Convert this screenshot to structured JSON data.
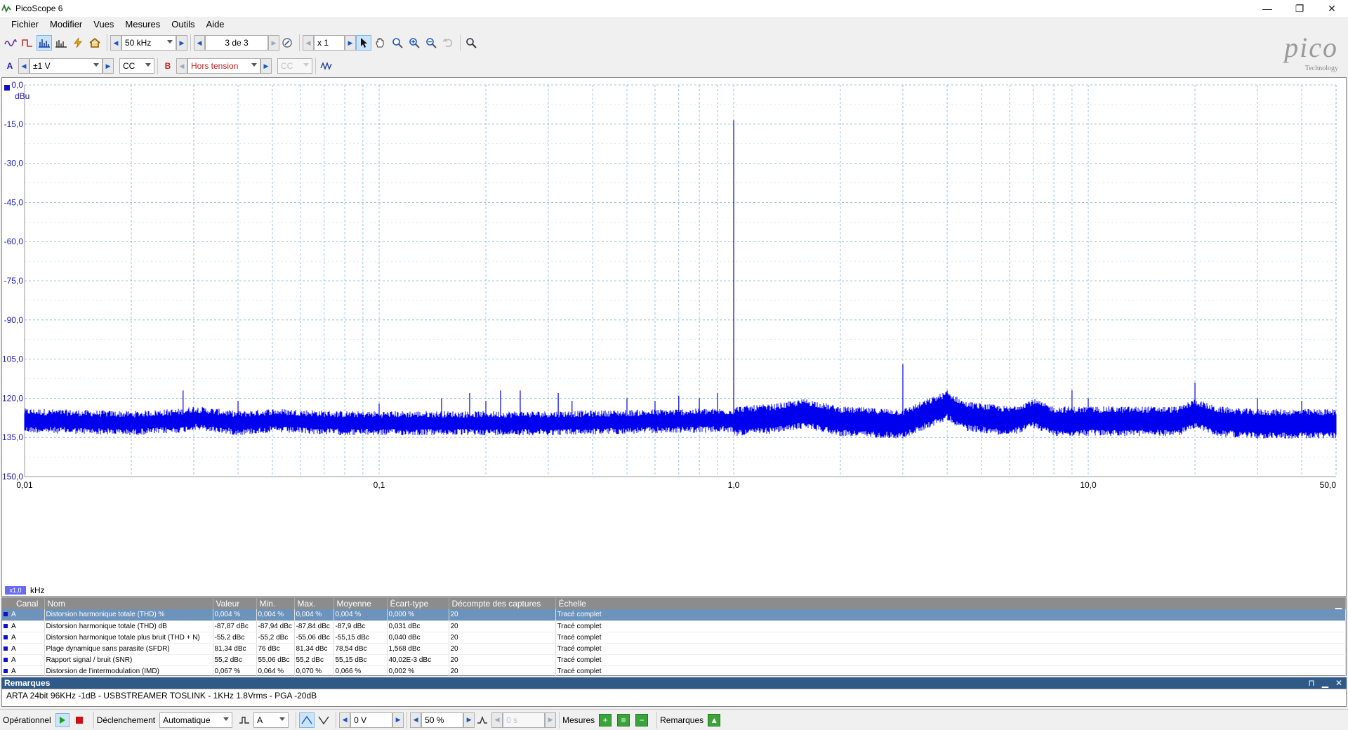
{
  "window": {
    "title": "PicoScope 6",
    "minimize": "—",
    "restore": "❐",
    "close": "✕"
  },
  "menu": [
    "Fichier",
    "Modifier",
    "Vues",
    "Mesures",
    "Outils",
    "Aide"
  ],
  "toolbar": {
    "timebase": "50 kHz",
    "capture": "3 de 3",
    "zoom": "x 1"
  },
  "channels": {
    "a_label": "A",
    "a_range": "±1 V",
    "a_coupling": "CC",
    "b_label": "B",
    "b_range": "Hors tension",
    "b_coupling": "CC"
  },
  "logo": {
    "name": "pico",
    "sub": "Technology"
  },
  "plot": {
    "y_unit": "dBu",
    "x_unit": "kHz",
    "x_scale_badge": "x1,0",
    "colors": {
      "trace": "#0000ee",
      "grid": "#7fb3d5"
    }
  },
  "chart_data": {
    "type": "line",
    "title": "",
    "xlabel": "kHz",
    "ylabel": "dBu",
    "x_scale": "log",
    "xlim": [
      0.01,
      50
    ],
    "ylim": [
      -150,
      0
    ],
    "y_ticks": [
      "0,0",
      "-15,0",
      "-30,0",
      "-45,0",
      "-60,0",
      "-75,0",
      "-90,0",
      "-105,0",
      "-120,0",
      "-135,0",
      "-150,0"
    ],
    "x_ticks": [
      {
        "value": 0.01,
        "label": "0,01"
      },
      {
        "value": 0.1,
        "label": "0,1"
      },
      {
        "value": 1.0,
        "label": "1,0"
      },
      {
        "value": 10.0,
        "label": "10,0"
      },
      {
        "value": 50.0,
        "label": "50,0"
      }
    ],
    "grid": true,
    "noise_floor": [
      [
        0.01,
        -128
      ],
      [
        0.02,
        -129
      ],
      [
        0.028,
        -128
      ],
      [
        0.03,
        -127
      ],
      [
        0.04,
        -129
      ],
      [
        0.05,
        -128
      ],
      [
        0.08,
        -129
      ],
      [
        0.1,
        -129
      ],
      [
        0.2,
        -129
      ],
      [
        0.3,
        -129
      ],
      [
        0.5,
        -128.5
      ],
      [
        0.8,
        -128
      ],
      [
        1.0,
        -128
      ],
      [
        1.3,
        -127
      ],
      [
        1.6,
        -125
      ],
      [
        2.0,
        -128
      ],
      [
        3.0,
        -129
      ],
      [
        4.0,
        -122
      ],
      [
        4.5,
        -126
      ],
      [
        6.0,
        -128
      ],
      [
        7.0,
        -125
      ],
      [
        8.0,
        -128
      ],
      [
        12.0,
        -128
      ],
      [
        18.0,
        -128
      ],
      [
        20.0,
        -125
      ],
      [
        23.0,
        -128
      ],
      [
        30.0,
        -129
      ],
      [
        50.0,
        -129
      ]
    ],
    "peaks": [
      {
        "x": 0.028,
        "y": -117
      },
      {
        "x": 0.04,
        "y": -121
      },
      {
        "x": 0.1,
        "y": -122
      },
      {
        "x": 0.15,
        "y": -120
      },
      {
        "x": 0.18,
        "y": -118
      },
      {
        "x": 0.2,
        "y": -121
      },
      {
        "x": 0.22,
        "y": -117
      },
      {
        "x": 0.25,
        "y": -117
      },
      {
        "x": 0.32,
        "y": -118
      },
      {
        "x": 0.35,
        "y": -121
      },
      {
        "x": 0.5,
        "y": -120
      },
      {
        "x": 0.6,
        "y": -121
      },
      {
        "x": 0.7,
        "y": -119
      },
      {
        "x": 0.8,
        "y": -120
      },
      {
        "x": 0.9,
        "y": -118
      },
      {
        "x": 1.0,
        "y": -13.5
      },
      {
        "x": 3.0,
        "y": -107
      },
      {
        "x": 4.0,
        "y": -117
      },
      {
        "x": 9.0,
        "y": -117
      },
      {
        "x": 10.0,
        "y": -120
      },
      {
        "x": 20.0,
        "y": -114
      },
      {
        "x": 30.0,
        "y": -120
      },
      {
        "x": 40.0,
        "y": -121
      }
    ]
  },
  "table": {
    "headers": [
      "Canal",
      "Nom",
      "Valeur",
      "Min.",
      "Max.",
      "Moyenne",
      "Écart-type",
      "Décompte des captures",
      "Échelle"
    ],
    "rows": [
      [
        "A",
        "Distorsion harmonique totale (THD) %",
        "0,004 %",
        "0,004 %",
        "0,004 %",
        "0,004 %",
        "0,000 %",
        "20",
        "Tracé complet"
      ],
      [
        "A",
        "Distorsion harmonique totale (THD) dB",
        "-87,87 dBc",
        "-87,94 dBc",
        "-87,84 dBc",
        "-87,9 dBc",
        "0,031 dBc",
        "20",
        "Tracé complet"
      ],
      [
        "A",
        "Distorsion harmonique totale plus bruit (THD + N)",
        "-55,2 dBc",
        "-55,2 dBc",
        "-55,06 dBc",
        "-55,15 dBc",
        "0,040 dBc",
        "20",
        "Tracé complet"
      ],
      [
        "A",
        "Plage dynamique sans parasite (SFDR)",
        "81,34 dBc",
        "76 dBc",
        "81,34 dBc",
        "78,54 dBc",
        "1,568 dBc",
        "20",
        "Tracé complet"
      ],
      [
        "A",
        "Rapport signal / bruit (SNR)",
        "55,2 dBc",
        "55,06 dBc",
        "55,2 dBc",
        "55,15 dBc",
        "40,02E-3 dBc",
        "20",
        "Tracé complet"
      ],
      [
        "A",
        "Distorsion de l'intermodulation (IMD)",
        "0,067 %",
        "0,064 %",
        "0,070 %",
        "0,066 %",
        "0,002 %",
        "20",
        "Tracé complet"
      ]
    ]
  },
  "remarks": {
    "title": "Remarques",
    "text": "ARTA 24bit 96KHz -1dB - USBSTREAMER TOSLINK - 1KHz 1.8Vrms - PGA -20dB"
  },
  "status": {
    "state": "Opérationnel",
    "trigger_label": "Déclenchement",
    "trigger_mode": "Automatique",
    "trigger_channel": "A",
    "trigger_level": "0 V",
    "pretrigger": "50 %",
    "delay": "0 s",
    "measures_label": "Mesures",
    "remarks_label": "Remarques"
  }
}
